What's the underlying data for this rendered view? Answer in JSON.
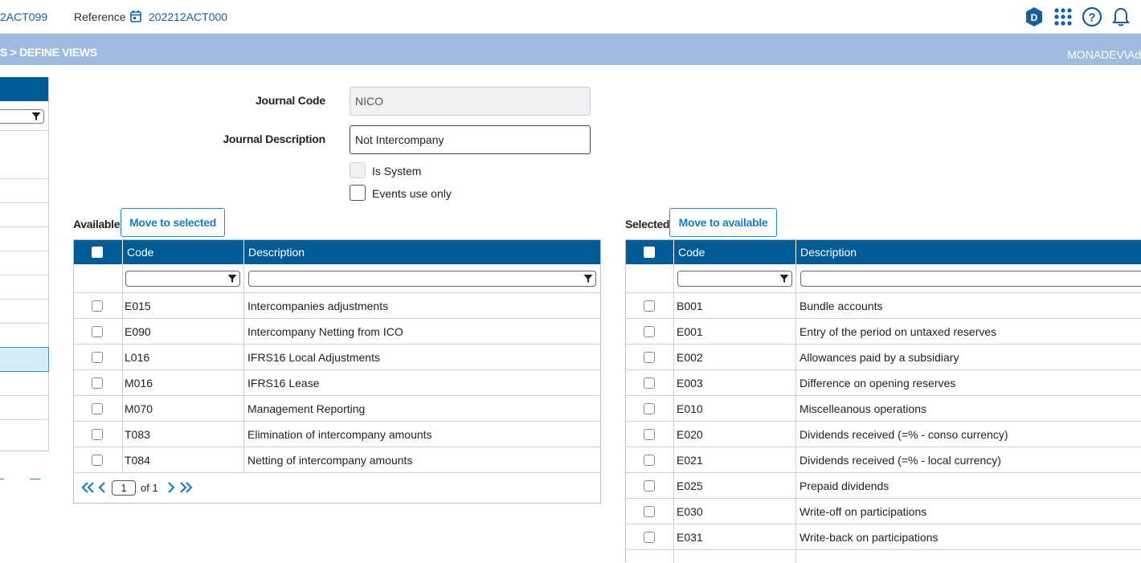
{
  "topbar": {
    "left_code": "2ACT099",
    "reference_label": "Reference",
    "reference_value": "202212ACT000"
  },
  "breadcrumb": "S > DEFINE VIEWS",
  "user": "MONADEV\\Ad",
  "form": {
    "journal_code_label": "Journal Code",
    "journal_code_value": "NICO",
    "journal_description_label": "Journal Description",
    "journal_description_value": "Not Intercompany",
    "is_system_label": "Is System",
    "events_use_only_label": "Events use only"
  },
  "available": {
    "label": "Available",
    "button": "Move to selected",
    "columns": [
      "Code",
      "Description"
    ],
    "rows": [
      {
        "code": "E015",
        "description": "Intercompanies adjustments"
      },
      {
        "code": "E090",
        "description": "Intercompany Netting from ICO"
      },
      {
        "code": "L016",
        "description": "IFRS16 Local Adjustments"
      },
      {
        "code": "M016",
        "description": "IFRS16 Lease"
      },
      {
        "code": "M070",
        "description": "Management Reporting"
      },
      {
        "code": "T083",
        "description": "Elimination of intercompany amounts"
      },
      {
        "code": "T084",
        "description": "Netting of intercompany amounts"
      }
    ],
    "pager": {
      "page": "1",
      "of_label": "of 1"
    }
  },
  "selected": {
    "label": "Selected",
    "button": "Move to available",
    "columns": [
      "Code",
      "Description"
    ],
    "rows": [
      {
        "code": "B001",
        "description": "Bundle accounts"
      },
      {
        "code": "E001",
        "description": "Entry of the period on untaxed reserves"
      },
      {
        "code": "E002",
        "description": "Allowances paid by a subsidiary"
      },
      {
        "code": "E003",
        "description": "Difference on opening reserves"
      },
      {
        "code": "E010",
        "description": "Miscelleanous operations"
      },
      {
        "code": "E020",
        "description": "Dividends received (=% - conso currency)"
      },
      {
        "code": "E021",
        "description": "Dividends received (=% - local currency)"
      },
      {
        "code": "E025",
        "description": "Prepaid dividends"
      },
      {
        "code": "E030",
        "description": "Write-off on participations"
      },
      {
        "code": "E031",
        "description": "Write-back on participations"
      }
    ]
  },
  "icons": [
    "calendar-icon",
    "d-badge-icon",
    "apps-grid-icon",
    "help-icon",
    "bell-icon",
    "filter-icon",
    "first-page-icon",
    "prev-page-icon",
    "next-page-icon",
    "last-page-icon"
  ],
  "colors": {
    "header_blue": "#005b96",
    "breadcrumb_bar": "#9ebcdd",
    "accent": "#1a7cc0"
  }
}
